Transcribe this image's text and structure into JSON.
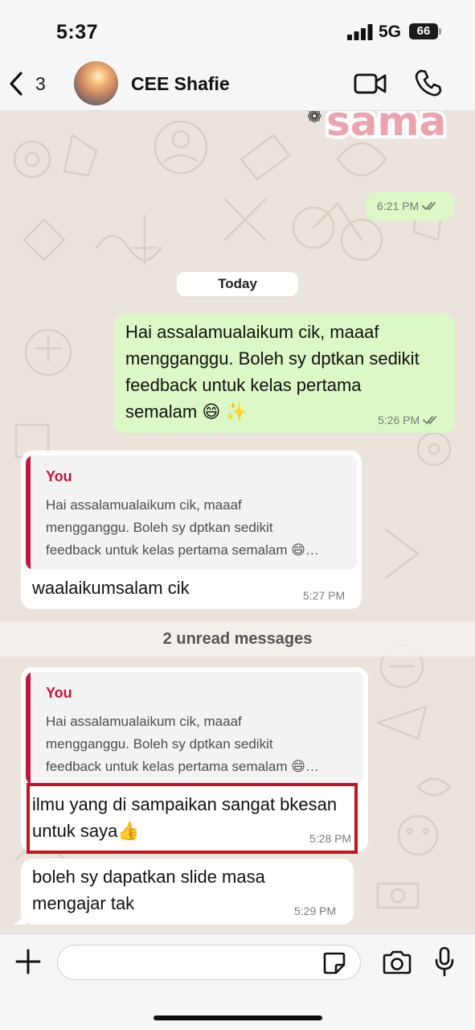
{
  "status_bar": {
    "time": "5:37",
    "network": "5G",
    "battery": "66"
  },
  "header": {
    "back_count": "3",
    "contact_name": "CEE Shafie"
  },
  "sticker_text": "sama",
  "messages": [
    {
      "direction": "outgoing",
      "time": "6:21 PM",
      "read": true
    },
    {
      "direction": "outgoing",
      "lines": [
        "Hai assalamualaikum cik, maaaf",
        "mengganggu. Boleh sy dptkan sedikit",
        "feedback untuk kelas pertama",
        "semalam 😄 ✨"
      ],
      "time": "5:26 PM",
      "read": true
    },
    {
      "direction": "incoming",
      "quote": {
        "author": "You",
        "lines": [
          "Hai assalamualaikum cik, maaaf",
          "mengganggu. Boleh sy dptkan sedikit",
          "feedback untuk kelas pertama semalam 😄…"
        ]
      },
      "text": "waalaikumsalam cik",
      "time": "5:27 PM"
    },
    {
      "direction": "incoming",
      "quote": {
        "author": "You",
        "lines": [
          "Hai assalamualaikum cik, maaaf",
          "mengganggu. Boleh sy dptkan sedikit",
          "feedback untuk kelas pertama semalam 😄…"
        ]
      },
      "lines": [
        "ilmu yang di sampaikan sangat bkesan",
        "untuk saya👍"
      ],
      "time": "5:28 PM",
      "highlighted": true
    },
    {
      "direction": "incoming",
      "lines": [
        "boleh sy dapatkan slide masa",
        "mengajar tak"
      ],
      "time": "5:29 PM"
    }
  ],
  "date_separator": "Today",
  "unread_banner": "2 unread messages",
  "composer": {
    "value": "",
    "placeholder": ""
  },
  "colors": {
    "outgoing_bubble": "#dbf8c6",
    "incoming_bubble": "#ffffff",
    "quote_accent": "#c3163a",
    "highlight_border": "#c4121f",
    "wallpaper": "#ebe4dc"
  },
  "icons": {
    "back": "chevron-left-icon",
    "video": "video-camera-icon",
    "call": "phone-icon",
    "plus": "plus-icon",
    "sticker": "sticker-icon",
    "camera": "camera-icon",
    "mic": "microphone-icon",
    "read": "double-check-icon"
  }
}
